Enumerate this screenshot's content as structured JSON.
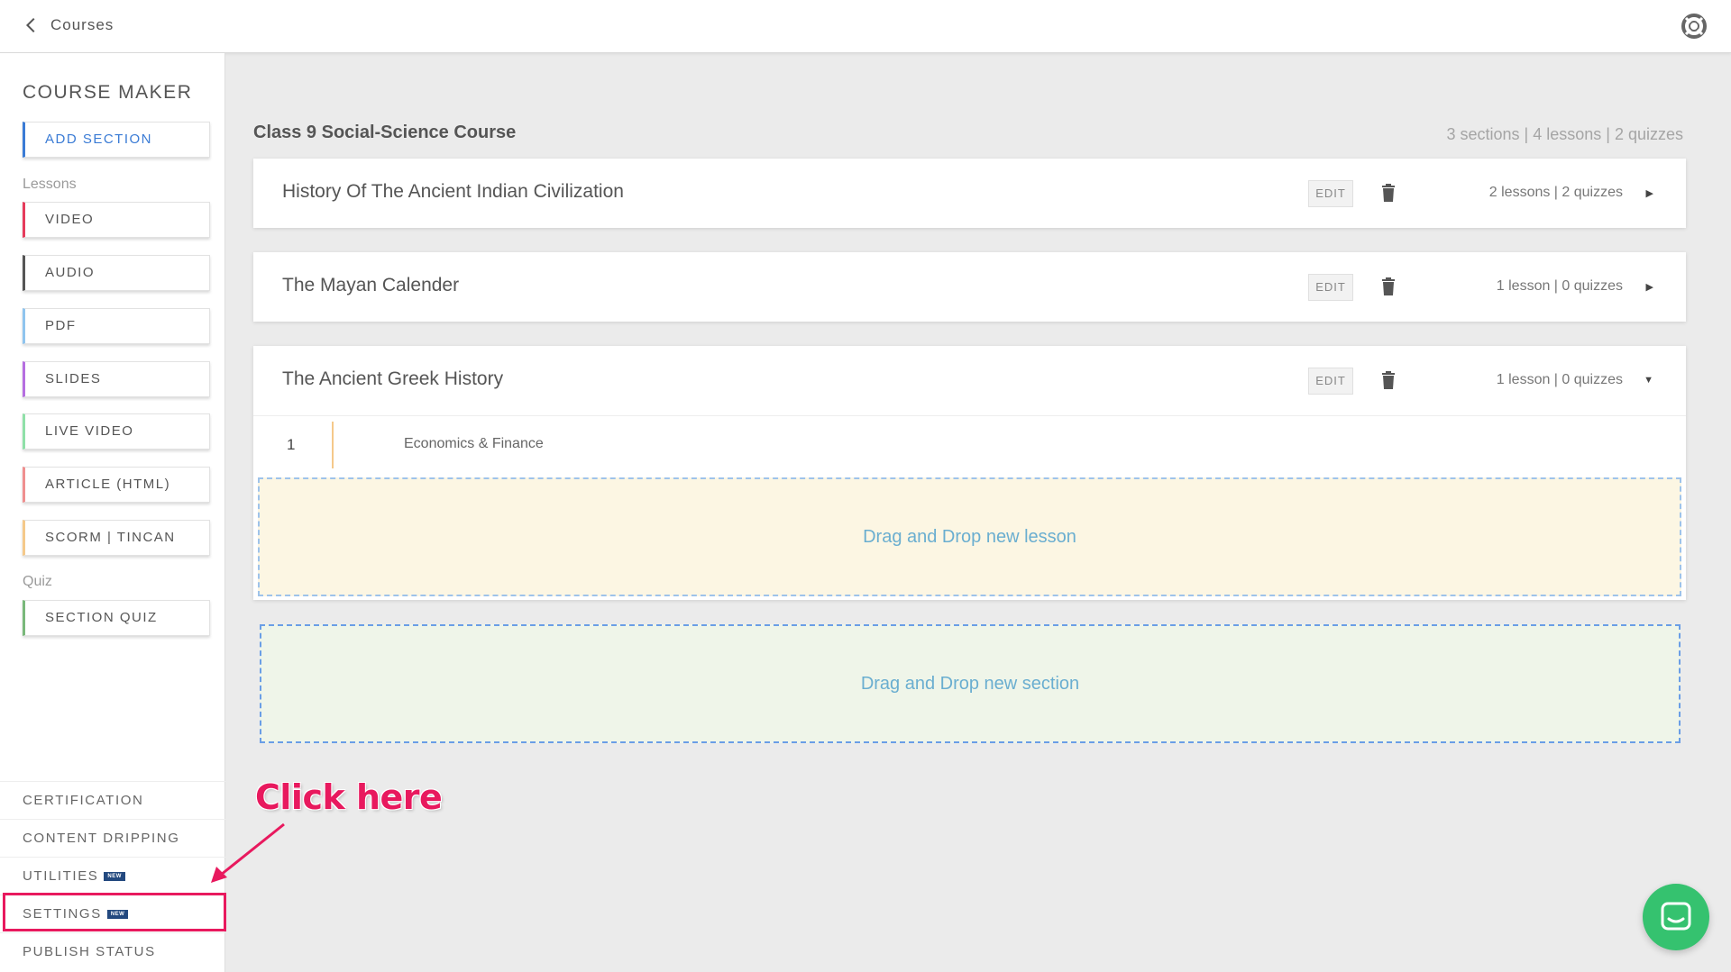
{
  "topbar": {
    "back_label": "Courses",
    "help_icon": "lifebuoy-icon"
  },
  "sidebar": {
    "title": "COURSE MAKER",
    "add_section": "ADD SECTION",
    "lessons_label": "Lessons",
    "lesson_tools": [
      {
        "label": "VIDEO",
        "color": "#e63b5b"
      },
      {
        "label": "AUDIO",
        "color": "#555555"
      },
      {
        "label": "PDF",
        "color": "#8fc4ee"
      },
      {
        "label": "SLIDES",
        "color": "#b56ee0"
      },
      {
        "label": "LIVE VIDEO",
        "color": "#8fe0a8"
      },
      {
        "label": "ARTICLE (HTML)",
        "color": "#ef8f8f"
      },
      {
        "label": "SCORM | TINCAN",
        "color": "#f5c98a"
      }
    ],
    "quiz_label": "Quiz",
    "quiz_tool": {
      "label": "SECTION QUIZ",
      "color": "#79b87a"
    },
    "bottom_items": [
      {
        "label": "CERTIFICATION",
        "new": false
      },
      {
        "label": "CONTENT DRIPPING",
        "new": false
      },
      {
        "label": "UTILITIES",
        "new": true
      },
      {
        "label": "SETTINGS",
        "new": true
      },
      {
        "label": "PUBLISH STATUS",
        "new": false
      }
    ],
    "new_badge": "NEW"
  },
  "course": {
    "title": "Class 9 Social-Science Course",
    "stats": "3 sections | 4 lessons | 2 quizzes",
    "edit_label": "EDIT",
    "sections": [
      {
        "name": "History Of The Ancient Indian Civilization",
        "stats": "2 lessons | 2 quizzes",
        "toggle": "▶"
      },
      {
        "name": "The Mayan Calender",
        "stats": "1 lesson | 0 quizzes",
        "toggle": "▶"
      },
      {
        "name": "The Ancient Greek History",
        "stats": "1 lesson | 0 quizzes",
        "toggle": "▼",
        "lessons": [
          {
            "number": "1",
            "title": "Economics & Finance"
          }
        ]
      }
    ],
    "drop_lesson": "Drag and Drop new lesson",
    "drop_section": "Drag and Drop new section"
  },
  "annotation": {
    "text": "Click here",
    "color": "#e8195e"
  },
  "chat": {
    "icon": "chat-icon",
    "color": "#35c26f"
  }
}
